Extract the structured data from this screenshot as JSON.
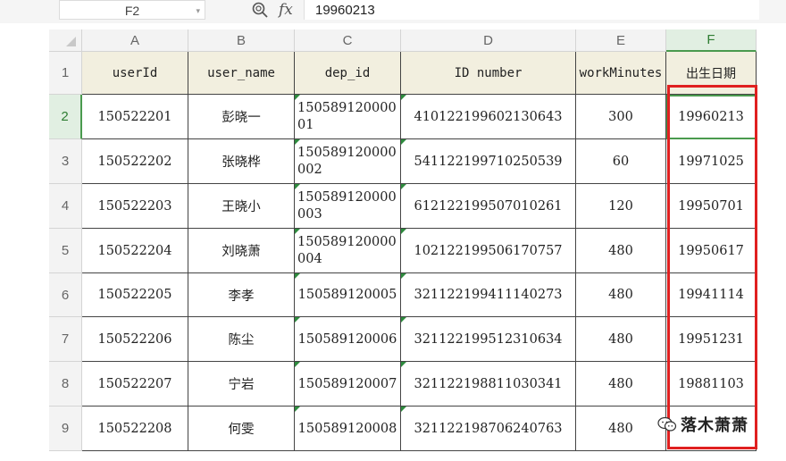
{
  "formula_bar": {
    "cell_ref": "F2",
    "fx_label": "fx",
    "formula_value": "19960213"
  },
  "columns": [
    "A",
    "B",
    "C",
    "D",
    "E",
    "F"
  ],
  "rows": [
    "1",
    "2",
    "3",
    "4",
    "5",
    "6",
    "7",
    "8",
    "9"
  ],
  "header_row": [
    "userId",
    "user_name",
    "dep_id",
    "ID number",
    "workMinutes",
    "出生日期"
  ],
  "table": [
    [
      "150522201",
      "彭晓一",
      "15058912000001",
      "410122199602130643",
      "300",
      "19960213"
    ],
    [
      "150522202",
      "张晓桦",
      "150589120000002",
      "541122199710250539",
      "60",
      "19971025"
    ],
    [
      "150522203",
      "王晓小",
      "150589120000003",
      "612122199507010261",
      "120",
      "19950701"
    ],
    [
      "150522204",
      "刘晓萧",
      "150589120000004",
      "102122199506170757",
      "480",
      "19950617"
    ],
    [
      "150522205",
      "李孝",
      "150589120005",
      "321122199411140273",
      "480",
      "19941114"
    ],
    [
      "150522206",
      "陈尘",
      "150589120006",
      "321122199512310634",
      "480",
      "19951231"
    ],
    [
      "150522207",
      "宁岩",
      "150589120007",
      "321122198811030341",
      "480",
      "19881103"
    ],
    [
      "150522208",
      "何雯",
      "150589120008",
      "321122198706240763",
      "480",
      ""
    ]
  ],
  "watermark": {
    "text": "落木萧萧",
    "icon": "wechat-icon"
  },
  "colors": {
    "selection": "#4a9a4e",
    "highlight_box": "#e02020",
    "header_fill": "#f2efdf"
  }
}
